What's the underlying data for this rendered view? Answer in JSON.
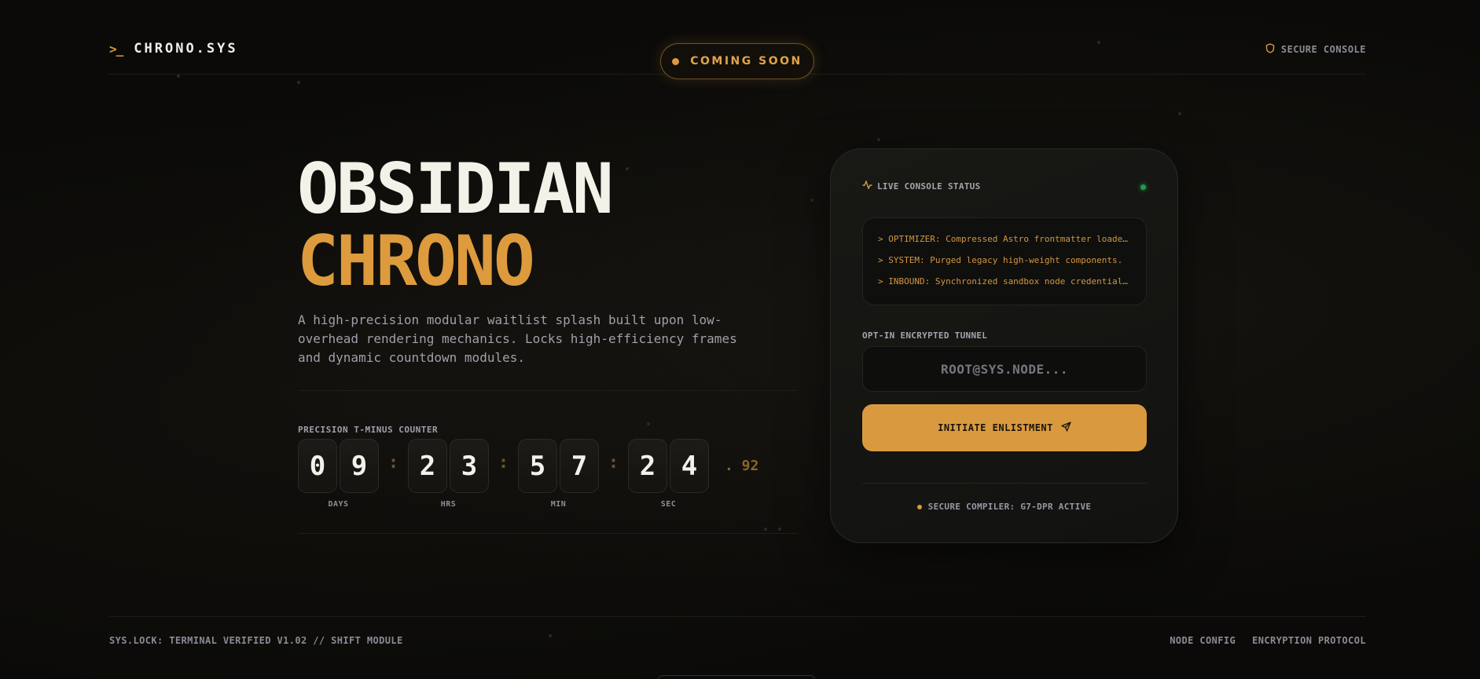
{
  "header": {
    "brand_icon": ">_",
    "brand_name": "CHRONO.SYS",
    "status_pill": "COMING SOON",
    "secure_label": "SECURE CONSOLE",
    "secure_icon": "shield-icon"
  },
  "hero": {
    "title_line1": "OBSIDIAN",
    "title_line2": "CHRONO",
    "description": "A high-precision modular waitlist splash built upon low-overhead rendering mechanics. Locks high-efficiency frames and dynamic countdown modules."
  },
  "counter": {
    "label": "PRECISION T-MINUS COUNTER",
    "days": [
      "0",
      "9"
    ],
    "hours": [
      "2",
      "3"
    ],
    "minutes": [
      "5",
      "7"
    ],
    "seconds": [
      "2",
      "4"
    ],
    "separator": ":",
    "milliseconds": ". 92",
    "units": {
      "days": "DAYS",
      "hours": "HRS",
      "minutes": "MIN",
      "seconds": "SEC"
    }
  },
  "console": {
    "title": "LIVE CONSOLE STATUS",
    "title_icon": "activity-icon",
    "log": [
      "> OPTIMIZER: Compressed Astro frontmatter loaders.",
      "> SYSTEM: Purged legacy high-weight components.",
      "> INBOUND: Synchronized sandbox node credentials."
    ],
    "tunnel_label": "OPT-IN ENCRYPTED TUNNEL",
    "tunnel_placeholder": "ROOT@SYS.NODE...",
    "tunnel_value": "",
    "submit_label": "INITIATE ENLISTMENT",
    "submit_icon": "send-icon",
    "compiler_status": "SECURE COMPILER: G7-DPR ACTIVE"
  },
  "footer": {
    "left_text": "SYS.LOCK: TERMINAL VERIFIED V1.02 // SHIFT MODULE",
    "links": [
      "NODE CONFIG",
      "ENCRYPTION PROTOCOL"
    ]
  },
  "colors": {
    "accent": "#d99a3f",
    "background": "#0b0a08",
    "status_online": "#1e9a4b",
    "text_primary": "#f4f1e8",
    "text_muted": "#8c8a95"
  }
}
